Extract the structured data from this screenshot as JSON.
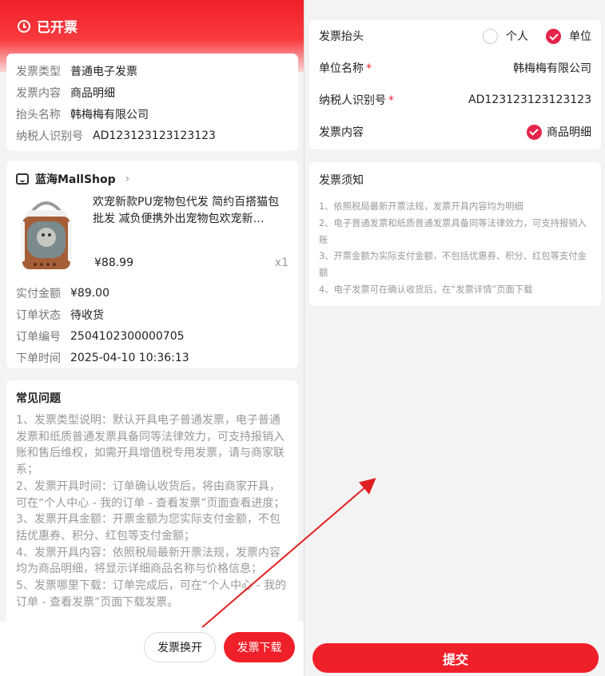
{
  "left": {
    "status_title": "已开票",
    "invoice_info": [
      {
        "label": "发票类型",
        "value": "普通电子发票"
      },
      {
        "label": "发票内容",
        "value": "商品明细"
      },
      {
        "label": "抬头名称",
        "value": "韩梅梅有限公司"
      },
      {
        "label": "纳税人识别号",
        "value": "AD123123123123123"
      }
    ],
    "shop": {
      "name": "蓝海MallShop",
      "chevron": "›"
    },
    "product": {
      "title": "欢宠新款PU宠物包代发 简约百搭猫包批发 减负便携外出宠物包欢宠新…",
      "price": "¥88.99",
      "qty": "x1"
    },
    "order_info": [
      {
        "label": "实付金额",
        "value": "¥89.00"
      },
      {
        "label": "订单状态",
        "value": "待收货"
      },
      {
        "label": "订单编号",
        "value": "2504102300000705"
      },
      {
        "label": "下单时间",
        "value": "2025-04-10 10:36:13"
      }
    ],
    "faq": {
      "title": "常见问题",
      "lines": [
        "1、发票类型说明：默认开具电子普通发票，电子普通发票和纸质普通发票具备同等法律效力，可支持报销入账和售后维权，如需开具增值税专用发票，请与商家联系；",
        "2、发票开具时间：订单确认收货后，将由商家开具，可在“个人中心 - 我的订单 - 查看发票”页面查看进度；",
        "3、发票开具金额：开票金额为您实际支付金额，不包括优惠券、积分、红包等支付金额；",
        "4、发票开具内容：依照税局最新开票法规，发票内容均为商品明细，将显示详细商品名称与价格信息；",
        "5、发票哪里下载：订单完成后，可在“个人中心 - 我的订单 - 查看发票”页面下载发票。"
      ]
    },
    "buttons": {
      "reissue": "发票换开",
      "download": "发票下载"
    }
  },
  "right": {
    "header_label": "发票抬头",
    "options": [
      {
        "label": "个人",
        "selected": false
      },
      {
        "label": "单位",
        "selected": true
      }
    ],
    "company_name_label": "单位名称",
    "company_name_value": "韩梅梅有限公司",
    "taxpayer_label": "纳税人识别号",
    "taxpayer_value": "AD123123123123123",
    "content_label": "发票内容",
    "content_value": "商品明细",
    "required_mark": "*",
    "notice": {
      "title": "发票须知",
      "lines": [
        "1、依照税局最新开票法规，发票开具内容均为明细",
        "2、电子普通发票和纸质普通发票具备同等法律效力，可支持报销入账",
        "3、开票金额为实际支付金额，不包括优惠券、积分、红包等支付金额",
        "4、电子发票可在确认收货后，在“发票详情”页面下载"
      ]
    },
    "submit": "提交"
  },
  "colors": {
    "accent": "#f0202a",
    "check": "#e5254a",
    "arrow": "#e02020"
  }
}
